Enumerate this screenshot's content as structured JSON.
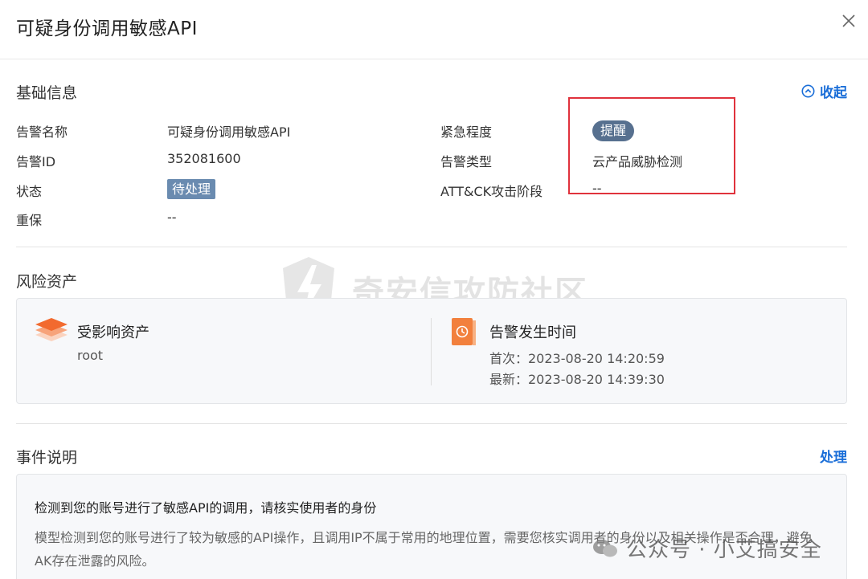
{
  "dialog": {
    "title": "可疑身份调用敏感API",
    "close_icon": "close-icon"
  },
  "basic": {
    "section_title": "基础信息",
    "collapse_label": "收起",
    "fields": {
      "alert_name_label": "告警名称",
      "alert_name_value": "可疑身份调用敏感API",
      "alert_id_label": "告警ID",
      "alert_id_value": "352081600",
      "status_label": "状态",
      "status_value": "待处理",
      "protection_label": "重保",
      "protection_value": "--",
      "urgency_label": "紧急程度",
      "urgency_value": "提醒",
      "alert_type_label": "告警类型",
      "alert_type_value": "云产品威胁检测",
      "attck_label": "ATT&CK攻击阶段",
      "attck_value": "--"
    },
    "highlight_color": "#e0323c",
    "status_color": "#6a8bb0",
    "urgency_color": "#57708f"
  },
  "risk": {
    "section_title": "风险资产",
    "affected_title": "受影响资产",
    "affected_value": "root",
    "time_title": "告警发生时间",
    "first_time": "首次：2023-08-20 14:20:59",
    "latest_time": "最新：2023-08-20 14:39:30"
  },
  "event": {
    "section_title": "事件说明",
    "action_label": "处理",
    "headline": "检测到您的账号进行了敏感API的调用，请核实使用者的身份",
    "description": "模型检测到您的账号进行了较为敏感的API操作，且调用IP不属于常用的地理位置，需要您核实调用者的身份以及相关操作是否合理，避免AK存在泄露的风险。"
  },
  "watermarks": {
    "center": "奇安信攻防社区",
    "corner": "公众号 · 小艾搞安全"
  },
  "accent_color": "#1a6ed8"
}
